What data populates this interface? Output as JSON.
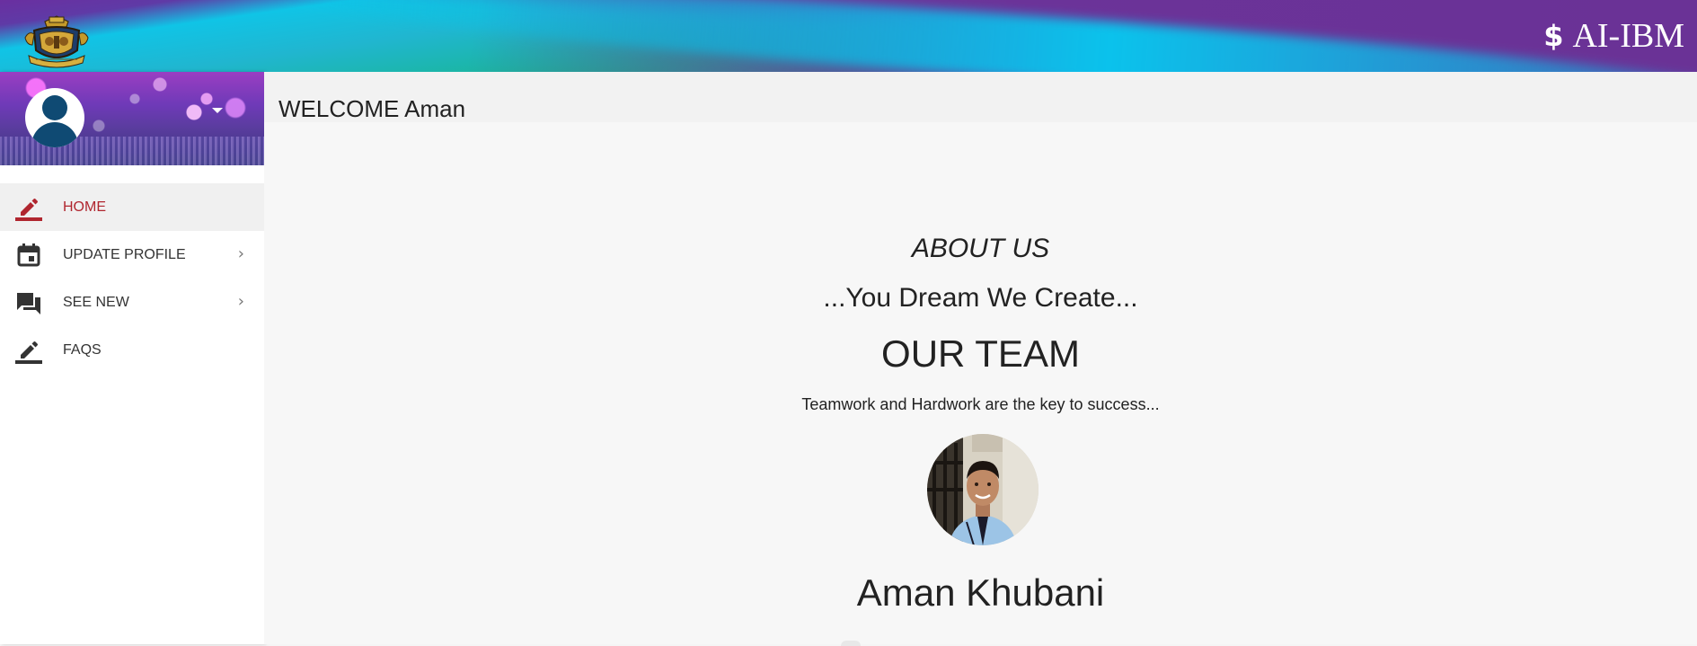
{
  "header": {
    "brand_icon": "dollar-icon",
    "brand_icon_glyph": "$",
    "brand_title": "AI-IBM",
    "logo": "crest-logo"
  },
  "sidebar": {
    "avatar": "user-avatar-icon",
    "menu_caret": "caret-down-icon",
    "items": [
      {
        "label": "HOME",
        "icon": "pencil-icon",
        "active": true,
        "has_submenu": false
      },
      {
        "label": "UPDATE PROFILE",
        "icon": "calendar-icon",
        "active": false,
        "has_submenu": true
      },
      {
        "label": "SEE NEW",
        "icon": "chat-icon",
        "active": false,
        "has_submenu": true
      },
      {
        "label": "FAQS",
        "icon": "pencil-icon",
        "active": false,
        "has_submenu": false
      }
    ]
  },
  "main": {
    "welcome": "WELCOME Aman",
    "about_title": "ABOUT US",
    "motto": "...You Dream We Create...",
    "team_title": "OUR TEAM",
    "tagline": "Teamwork and Hardwork are the key to success...",
    "member": {
      "name": "Aman Khubani",
      "photo": "member-photo"
    }
  },
  "colors": {
    "accent_active": "#b0262f",
    "avatar_blue": "#0f4a73",
    "header_purple": "#6a3296",
    "header_cyan": "#10c4e6",
    "header_green": "#19b58f"
  }
}
